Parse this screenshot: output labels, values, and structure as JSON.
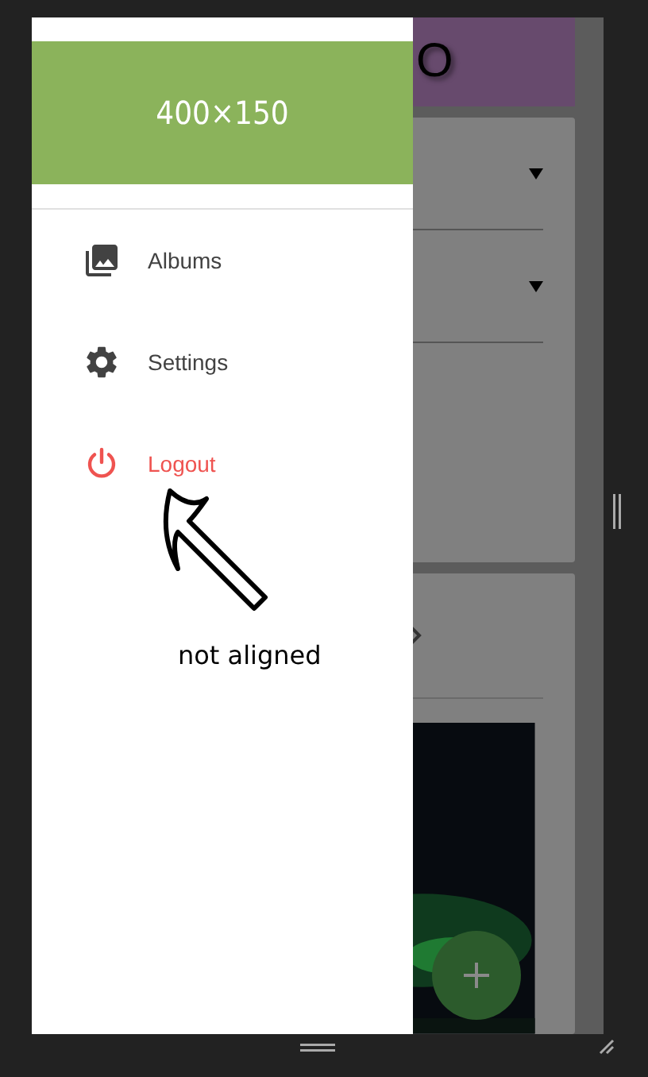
{
  "app_bar": {
    "title": "O"
  },
  "drawer": {
    "header_image": {
      "text": "400×150"
    },
    "items": [
      {
        "label": "Albums",
        "kind": "albums",
        "color": "#424242"
      },
      {
        "label": "Settings",
        "kind": "settings",
        "color": "#424242"
      },
      {
        "label": "Logout",
        "kind": "power",
        "color": "#ef5350"
      }
    ]
  },
  "annotation": {
    "text": "not aligned"
  }
}
